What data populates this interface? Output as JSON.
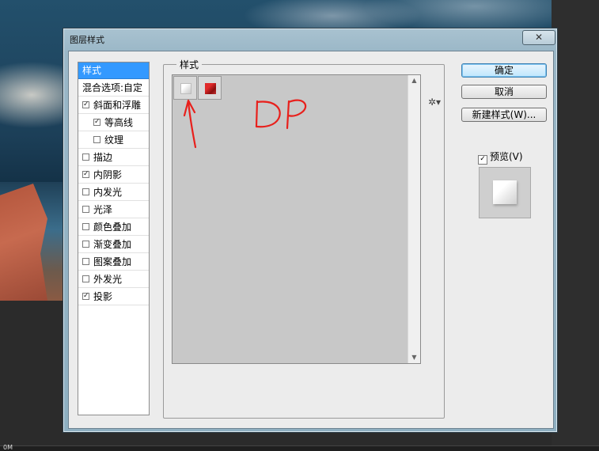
{
  "dialog": {
    "title": "图层样式",
    "close_label": "✕"
  },
  "style_list": {
    "items": [
      {
        "label": "样式",
        "checkbox": false,
        "checked": false,
        "indent": 0,
        "selected": true
      },
      {
        "label": "混合选项:自定",
        "checkbox": false,
        "checked": false,
        "indent": 0,
        "selected": false
      },
      {
        "label": "斜面和浮雕",
        "checkbox": true,
        "checked": true,
        "indent": 0,
        "selected": false
      },
      {
        "label": "等高线",
        "checkbox": true,
        "checked": true,
        "indent": 1,
        "selected": false
      },
      {
        "label": "纹理",
        "checkbox": true,
        "checked": false,
        "indent": 1,
        "selected": false
      },
      {
        "label": "描边",
        "checkbox": true,
        "checked": false,
        "indent": 0,
        "selected": false
      },
      {
        "label": "内阴影",
        "checkbox": true,
        "checked": true,
        "indent": 0,
        "selected": false
      },
      {
        "label": "内发光",
        "checkbox": true,
        "checked": false,
        "indent": 0,
        "selected": false
      },
      {
        "label": "光泽",
        "checkbox": true,
        "checked": false,
        "indent": 0,
        "selected": false
      },
      {
        "label": "颜色叠加",
        "checkbox": true,
        "checked": false,
        "indent": 0,
        "selected": false
      },
      {
        "label": "渐变叠加",
        "checkbox": true,
        "checked": false,
        "indent": 0,
        "selected": false
      },
      {
        "label": "图案叠加",
        "checkbox": true,
        "checked": false,
        "indent": 0,
        "selected": false
      },
      {
        "label": "外发光",
        "checkbox": true,
        "checked": false,
        "indent": 0,
        "selected": false
      },
      {
        "label": "投影",
        "checkbox": true,
        "checked": true,
        "indent": 0,
        "selected": false
      }
    ]
  },
  "styles_panel": {
    "legend": "样式",
    "gear_icon": "gear-icon",
    "swatches": [
      "default-style-swatch",
      "red-style-swatch"
    ]
  },
  "buttons": {
    "ok": "确定",
    "cancel": "取消",
    "new_style": "新建样式(W)..."
  },
  "preview": {
    "label": "预览(V)",
    "checked": true
  },
  "annotation": {
    "text": "DP",
    "color": "#e8201c"
  },
  "statusbar": {
    "text": "0M"
  },
  "colors": {
    "selection": "#3399ff",
    "dialog_frame": "#9ab7c7"
  }
}
